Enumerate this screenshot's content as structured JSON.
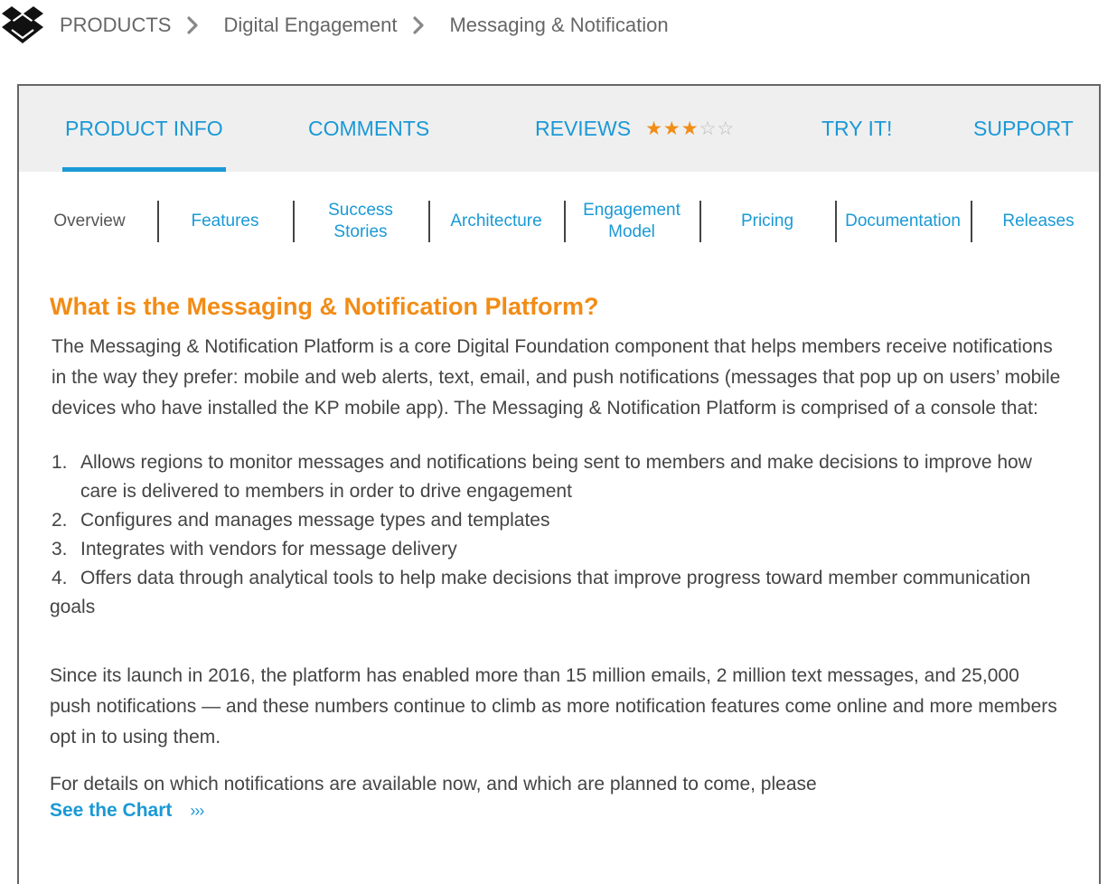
{
  "breadcrumb": {
    "items": [
      "PRODUCTS",
      "Digital Engagement",
      "Messaging & Notification"
    ]
  },
  "tabs": {
    "product_info": "PRODUCT INFO",
    "comments": "COMMENTS",
    "reviews": "REVIEWS",
    "reviews_rating": 3,
    "reviews_max": 5,
    "try_it": "TRY IT!",
    "support": "SUPPORT"
  },
  "subnav": {
    "overview": "Overview",
    "features": "Features",
    "success_stories": "Success Stories",
    "architecture": "Architecture",
    "engagement_model": "Engagement Model",
    "pricing": "Pricing",
    "documentation": "Documentation",
    "releases": "Releases"
  },
  "content": {
    "heading": "What is the Messaging & Notification Platform?",
    "intro": "The Messaging & Notification Platform is a core Digital Foundation component that helps members receive notifications in the way they prefer: mobile and web alerts, text, email, and push notifications (messages that pop up on users’ mobile devices who have installed the KP mobile app). The Messaging & Notification Platform is comprised of a console that:",
    "list": [
      {
        "num": "1.",
        "text": "Allows regions to monitor messages and notifications being sent to members and make decisions to improve how care is delivered to members in order to drive engagement"
      },
      {
        "num": "2.",
        "text": "Configures and manages message types and templates"
      },
      {
        "num": "3.",
        "text": "Integrates with vendors for message delivery"
      },
      {
        "num": "4.",
        "text": "Offers data through analytical tools to help make decisions that improve progress toward member communication goals"
      }
    ],
    "stats": "Since its launch in 2016, the platform has enabled more than 15 million emails, 2 million text messages, and 25,000 push notifications — and these numbers continue to climb as more notification features come online and more members opt in to using them.",
    "details": "For details on which notifications are available now, and which are planned to come, please",
    "see_chart": "See the Chart",
    "see_chart_arrows": "›››"
  },
  "colors": {
    "accent_blue": "#1a99d6",
    "accent_orange": "#f28c16",
    "tabbar_bg": "#efefef"
  },
  "icons": {
    "logo": "layered-diamonds-logo-icon",
    "breadcrumb_separator": "chevron-right-icon"
  }
}
